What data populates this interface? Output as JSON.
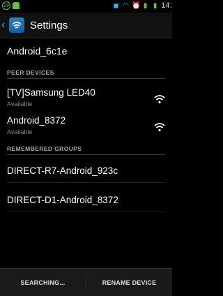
{
  "status_bar": {
    "badge": "29",
    "time": "14:",
    "icons": [
      "android-icon",
      "sim-icon",
      "wifi-icon",
      "alarm-icon",
      "signal-icon",
      "battery-icon"
    ],
    "accent": "#33b5e5"
  },
  "action_bar": {
    "title": "Settings",
    "icon": "wifi-settings-icon"
  },
  "device": {
    "name": "Android_6c1e"
  },
  "peer_devices": {
    "header": "PEER DEVICES",
    "items": [
      {
        "name": "[TV]Samsung LED40",
        "status": "Available",
        "icon": "wifi-signal-icon"
      },
      {
        "name": "Android_8372",
        "status": "Available",
        "icon": "wifi-signal-icon"
      }
    ]
  },
  "remembered_groups": {
    "header": "REMEMBERED GROUPS",
    "items": [
      {
        "name": "DIRECT-R7-Android_923c"
      },
      {
        "name": "DIRECT-D1-Android_8372"
      }
    ]
  },
  "bottom_bar": {
    "search_label": "SEARCHING...",
    "rename_label": "RENAME DEVICE"
  }
}
